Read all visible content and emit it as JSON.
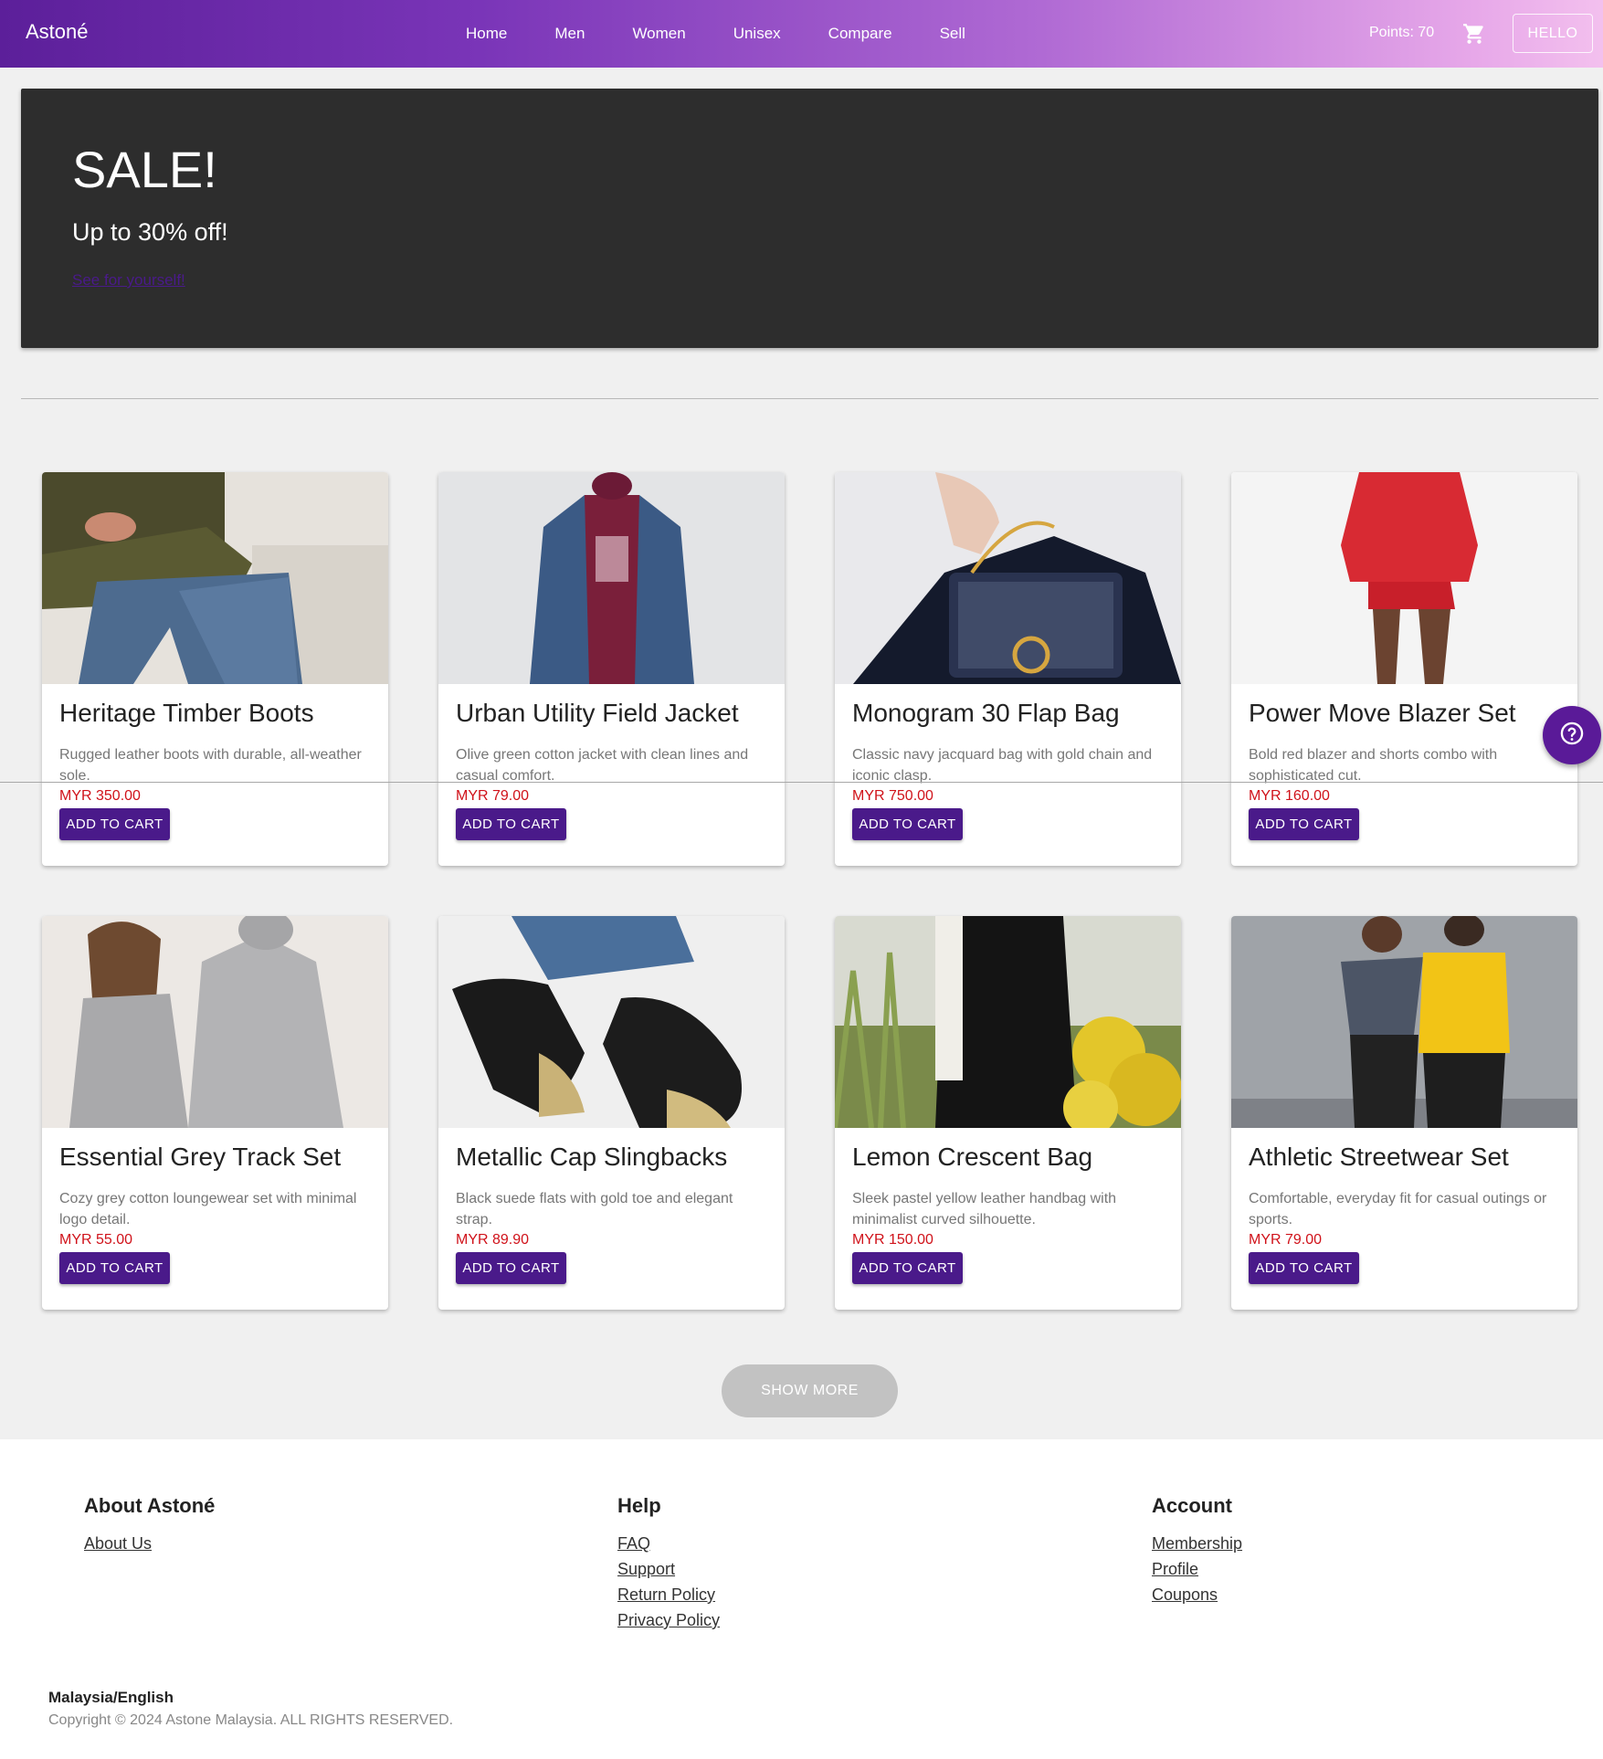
{
  "navbar": {
    "brand": "Astoné",
    "links": [
      "Home",
      "Men",
      "Women",
      "Unisex",
      "Compare",
      "Sell"
    ],
    "points": "Points: 70",
    "cart_icon": "shopping-cart-icon",
    "hello_label": "HELLO"
  },
  "hero": {
    "title": "SALE!",
    "subtitle": "Up to 30% off!",
    "link_text": "See for yourself!"
  },
  "products": [
    {
      "title": "Heritage Timber Boots",
      "description": "Rugged leather boots with durable, all-weather sole.",
      "price": "MYR 350.00",
      "button": "ADD TO CART"
    },
    {
      "title": "Urban Utility Field Jacket",
      "description": "Olive green cotton jacket with clean lines and casual comfort.",
      "price": "MYR 79.00",
      "button": "ADD TO CART"
    },
    {
      "title": "Monogram 30 Flap Bag",
      "description": "Classic navy jacquard bag with gold chain and iconic clasp.",
      "price": "MYR 750.00",
      "button": "ADD TO CART"
    },
    {
      "title": "Power Move Blazer Set",
      "description": "Bold red blazer and shorts combo with sophisticated cut.",
      "price": "MYR 160.00",
      "button": "ADD TO CART"
    },
    {
      "title": "Essential Grey Track Set",
      "description": "Cozy grey cotton loungewear set with minimal logo detail.",
      "price": "MYR 55.00",
      "button": "ADD TO CART"
    },
    {
      "title": "Metallic Cap Slingbacks",
      "description": "Black suede flats with gold toe and elegant strap.",
      "price": "MYR 89.90",
      "button": "ADD TO CART"
    },
    {
      "title": "Lemon Crescent Bag",
      "description": "Sleek pastel yellow leather handbag with minimalist curved silhouette.",
      "price": "MYR 150.00",
      "button": "ADD TO CART"
    },
    {
      "title": "Athletic Streetwear Set",
      "description": "Comfortable, everyday fit for casual outings or sports.",
      "price": "MYR 79.00",
      "button": "ADD TO CART"
    }
  ],
  "help_fab": {
    "icon": "help-circle-icon"
  },
  "show_more_label": "SHOW MORE",
  "footer": {
    "columns": [
      {
        "heading": "About Astoné",
        "links": [
          "About Us"
        ]
      },
      {
        "heading": "Help",
        "links": [
          "FAQ",
          "Support",
          "Return Policy",
          "Privacy Policy"
        ]
      },
      {
        "heading": "Account",
        "links": [
          "Membership",
          "Profile",
          "Coupons"
        ]
      }
    ],
    "locale": "Malaysia/English",
    "copyright": "Copyright © 2024 Astone Malaysia. ALL RIGHTS RESERVED."
  },
  "colors": {
    "primary": "#4a1a8a",
    "price": "#d0121a",
    "hero_bg": "#2d2d2d",
    "fab": "#5a1a98"
  }
}
